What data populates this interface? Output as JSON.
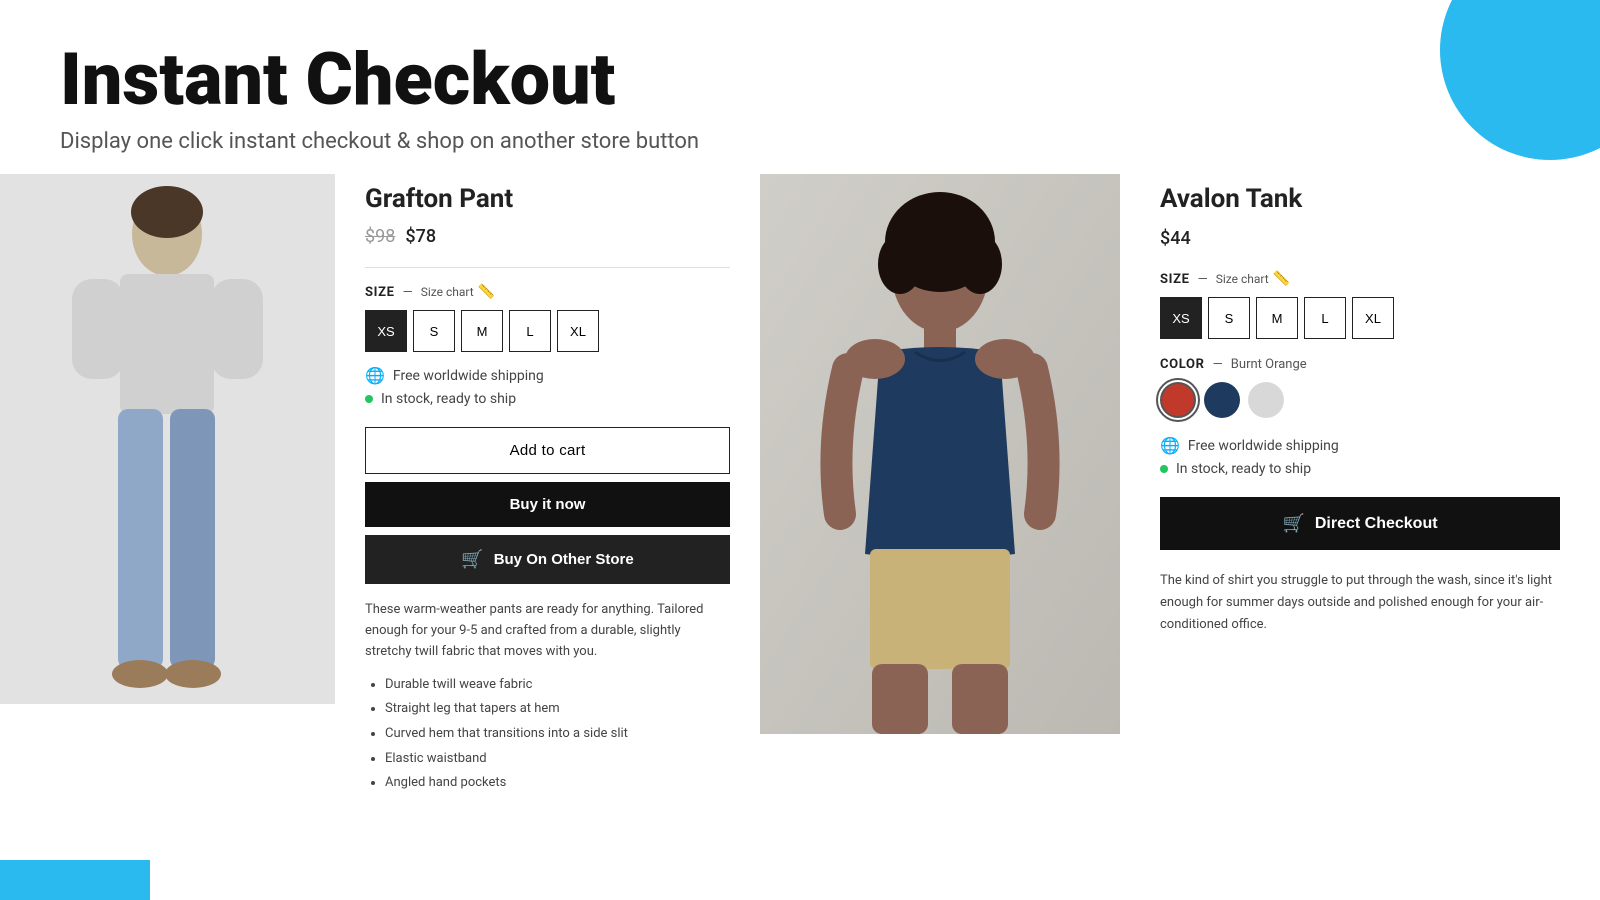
{
  "page": {
    "title": "Instant Checkout",
    "subtitle": "Display one click instant checkout & shop on another store button"
  },
  "left_product": {
    "name": "Grafton Pant",
    "price_original": "$98",
    "price_sale": "$78",
    "size_label": "SIZE",
    "size_chart_text": "Size chart",
    "sizes": [
      "XS",
      "S",
      "M",
      "L",
      "XL"
    ],
    "selected_size": "XS",
    "shipping_text": "Free worldwide shipping",
    "stock_text": "In stock, ready to ship",
    "btn_add_to_cart": "Add to cart",
    "btn_buy_now": "Buy it now",
    "btn_buy_other": "Buy On Other Store",
    "description": "These warm-weather pants are ready for anything. Tailored enough for your 9-5 and crafted from a durable, slightly stretchy twill fabric that moves with you.",
    "features": [
      "Durable twill weave fabric",
      "Straight leg that tapers at hem",
      "Curved hem that transitions into a side slit",
      "Elastic waistband",
      "Angled hand pockets"
    ]
  },
  "right_product": {
    "name": "Avalon Tank",
    "price": "$44",
    "size_label": "SIZE",
    "size_chart_text": "Size chart",
    "sizes": [
      "XS",
      "S",
      "M",
      "L",
      "XL"
    ],
    "selected_size": "XS",
    "color_label": "COLOR",
    "color_selected": "Burnt Orange",
    "colors": [
      {
        "name": "Burnt Orange",
        "class": "color-burnt-orange"
      },
      {
        "name": "Navy",
        "class": "color-navy"
      },
      {
        "name": "Light Gray",
        "class": "color-light-gray"
      }
    ],
    "shipping_text": "Free worldwide shipping",
    "stock_text": "In stock, ready to ship",
    "btn_direct_checkout": "Direct Checkout",
    "description": "The kind of shirt you struggle to put through the wash, since it's light enough for summer days outside and polished enough for your air-conditioned office."
  }
}
